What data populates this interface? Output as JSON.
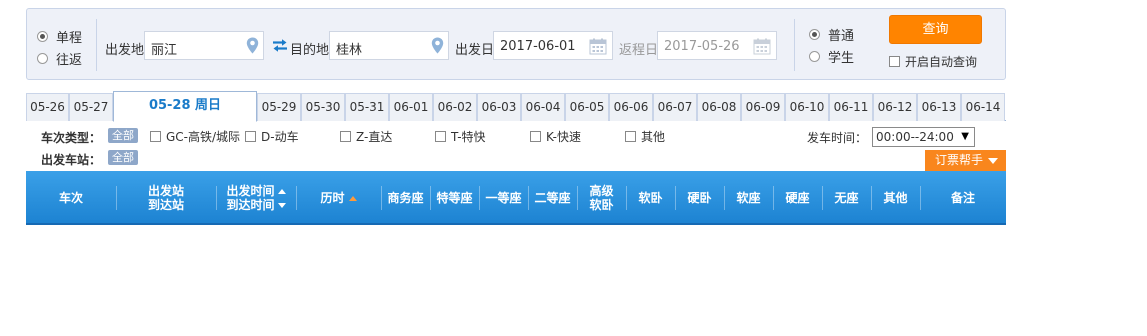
{
  "search": {
    "trip_types": [
      {
        "label": "单程",
        "checked": true
      },
      {
        "label": "往返",
        "checked": false
      }
    ],
    "from_label": "出发地",
    "from_value": "丽江",
    "to_label": "目的地",
    "to_value": "桂林",
    "depart_label": "出发日",
    "depart_value": "2017-06-01",
    "return_label": "返程日",
    "return_value": "2017-05-26",
    "passenger_types": [
      {
        "label": "普通",
        "checked": true
      },
      {
        "label": "学生",
        "checked": false
      }
    ],
    "query_label": "查询",
    "auto_query_label": "开启自动查询",
    "auto_query_checked": false,
    "icons": {
      "from": "location-pin-icon",
      "to": "location-pin-icon",
      "swap": "swap-arrows-icon",
      "calendar": "calendar-icon"
    }
  },
  "date_tabs": [
    "05-26",
    "05-27",
    "05-28 周日",
    "05-29",
    "05-30",
    "05-31",
    "06-01",
    "06-02",
    "06-03",
    "06-04",
    "06-05",
    "06-06",
    "06-07",
    "06-08",
    "06-09",
    "06-10",
    "06-11",
    "06-12",
    "06-13",
    "06-14"
  ],
  "active_date_index": 2,
  "filters": {
    "train_type_label": "车次类型：",
    "station_label": "出发车站：",
    "all_label": "全部",
    "train_types": [
      "GC-高铁/城际",
      "D-动车",
      "Z-直达",
      "T-特快",
      "K-快速",
      "其他"
    ],
    "depart_time_label": "发车时间：",
    "depart_time_value": "00:00--24:00",
    "help_label": "订票帮手"
  },
  "table_header": {
    "train_no": "车次",
    "station_from": "出发站",
    "station_to": "到达站",
    "time_from": "出发时间",
    "time_to": "到达时间",
    "duration": "历时",
    "seats": [
      "商务座",
      "特等座",
      "一等座",
      "二等座"
    ],
    "high_soft_1": "高级",
    "high_soft_2": "软卧",
    "seats2": [
      "软卧",
      "硬卧",
      "软座",
      "硬座",
      "无座",
      "其他"
    ],
    "remark": "备注"
  },
  "colors": {
    "accent_orange": "#ff8400",
    "header_blue": "#2b93de",
    "active_tab_text": "#1a7bc9",
    "search_bg": "#eef1f8",
    "all_tag": "#8ea7c9"
  }
}
